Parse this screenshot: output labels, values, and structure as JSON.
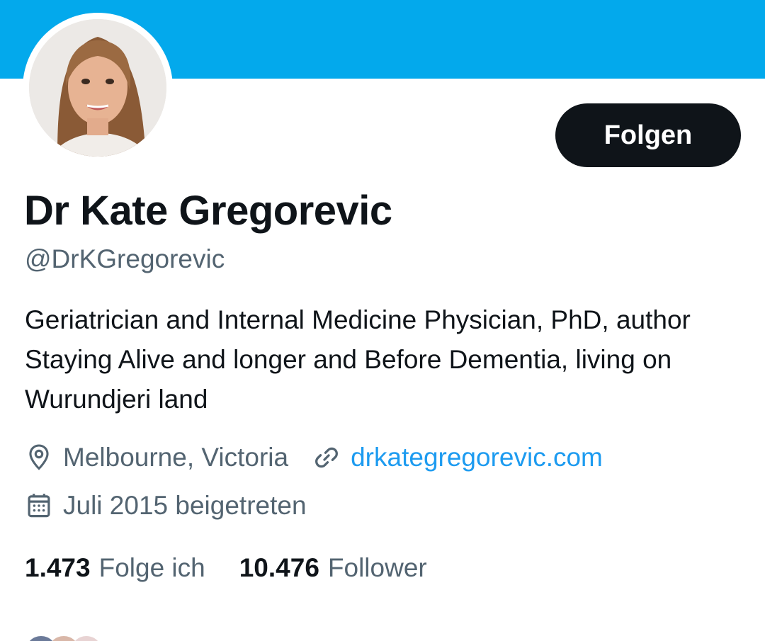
{
  "profile": {
    "name": "Dr Kate Gregorevic",
    "handle": "@DrKGregorevic",
    "bio": "Geriatrician and Internal Medicine Physician, PhD, author Staying Alive and longer and Before Dementia, living on Wurundjeri land",
    "location": "Melbourne, Victoria",
    "website": "drkategregorevic.com",
    "joined": "Juli 2015 beigetreten"
  },
  "actions": {
    "follow_label": "Folgen"
  },
  "stats": {
    "following_count": "1.473",
    "following_label": "Folge ich",
    "followers_count": "10.476",
    "followers_label": "Follower"
  },
  "icons": {
    "location": "location-pin-icon",
    "website": "link-icon",
    "joined": "calendar-icon"
  },
  "colors": {
    "banner": "#03a9ec",
    "primary_text": "#0f1419",
    "secondary_text": "#536471",
    "link": "#1d9bf0",
    "button_bg": "#0f1419"
  }
}
